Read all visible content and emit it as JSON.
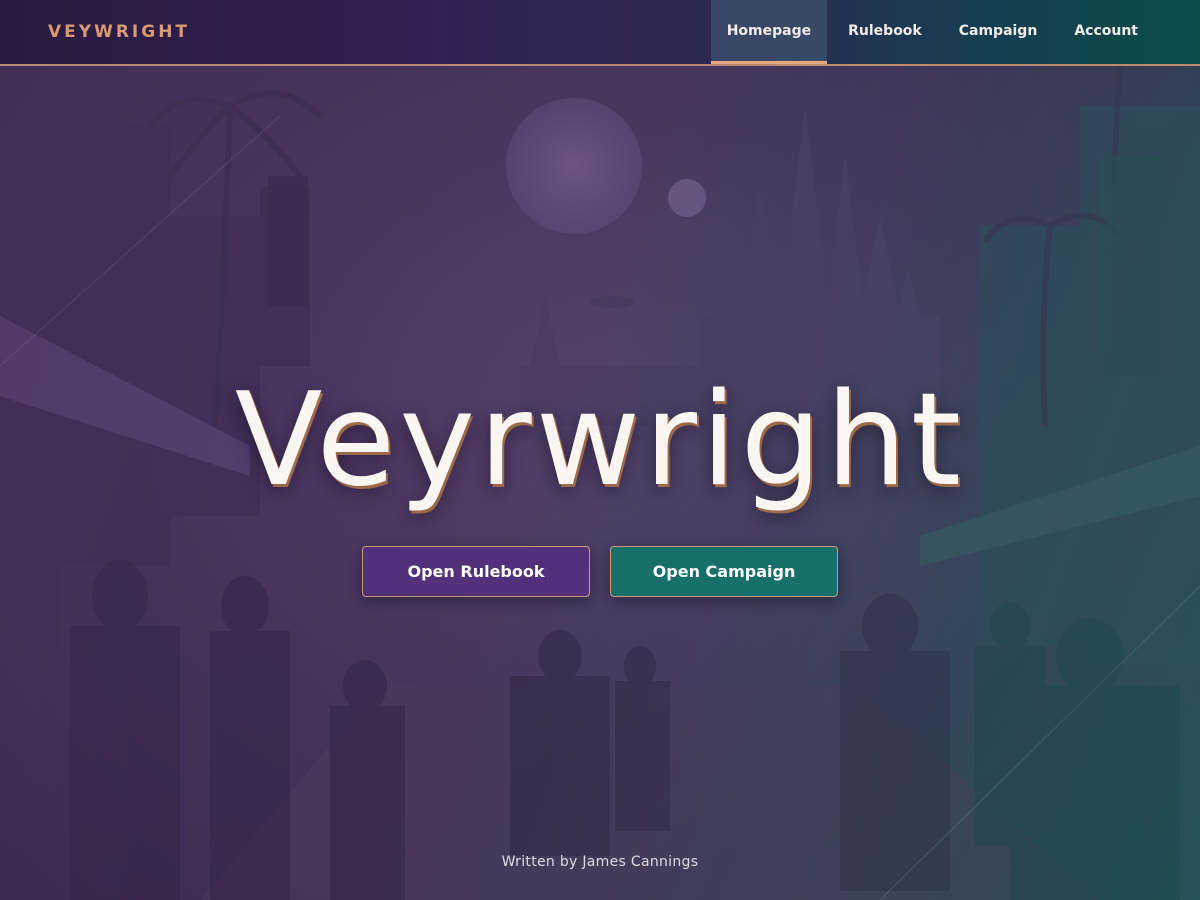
{
  "nav": {
    "brand": "VEYWRIGHT",
    "links": [
      {
        "label": "Homepage",
        "active": true
      },
      {
        "label": "Rulebook",
        "active": false
      },
      {
        "label": "Campaign",
        "active": false
      },
      {
        "label": "Account",
        "active": false
      }
    ]
  },
  "hero": {
    "title": "Veyrwright",
    "buttons": {
      "rulebook": "Open Rulebook",
      "campaign": "Open Campaign"
    },
    "byline": "Written by James Cannings"
  },
  "colors": {
    "brand_accent": "#d79a73",
    "nav_active_underline": "#e3a783",
    "rulebook_button": "#52307a",
    "campaign_button": "#176f69",
    "title_text": "#fbf6f1"
  }
}
